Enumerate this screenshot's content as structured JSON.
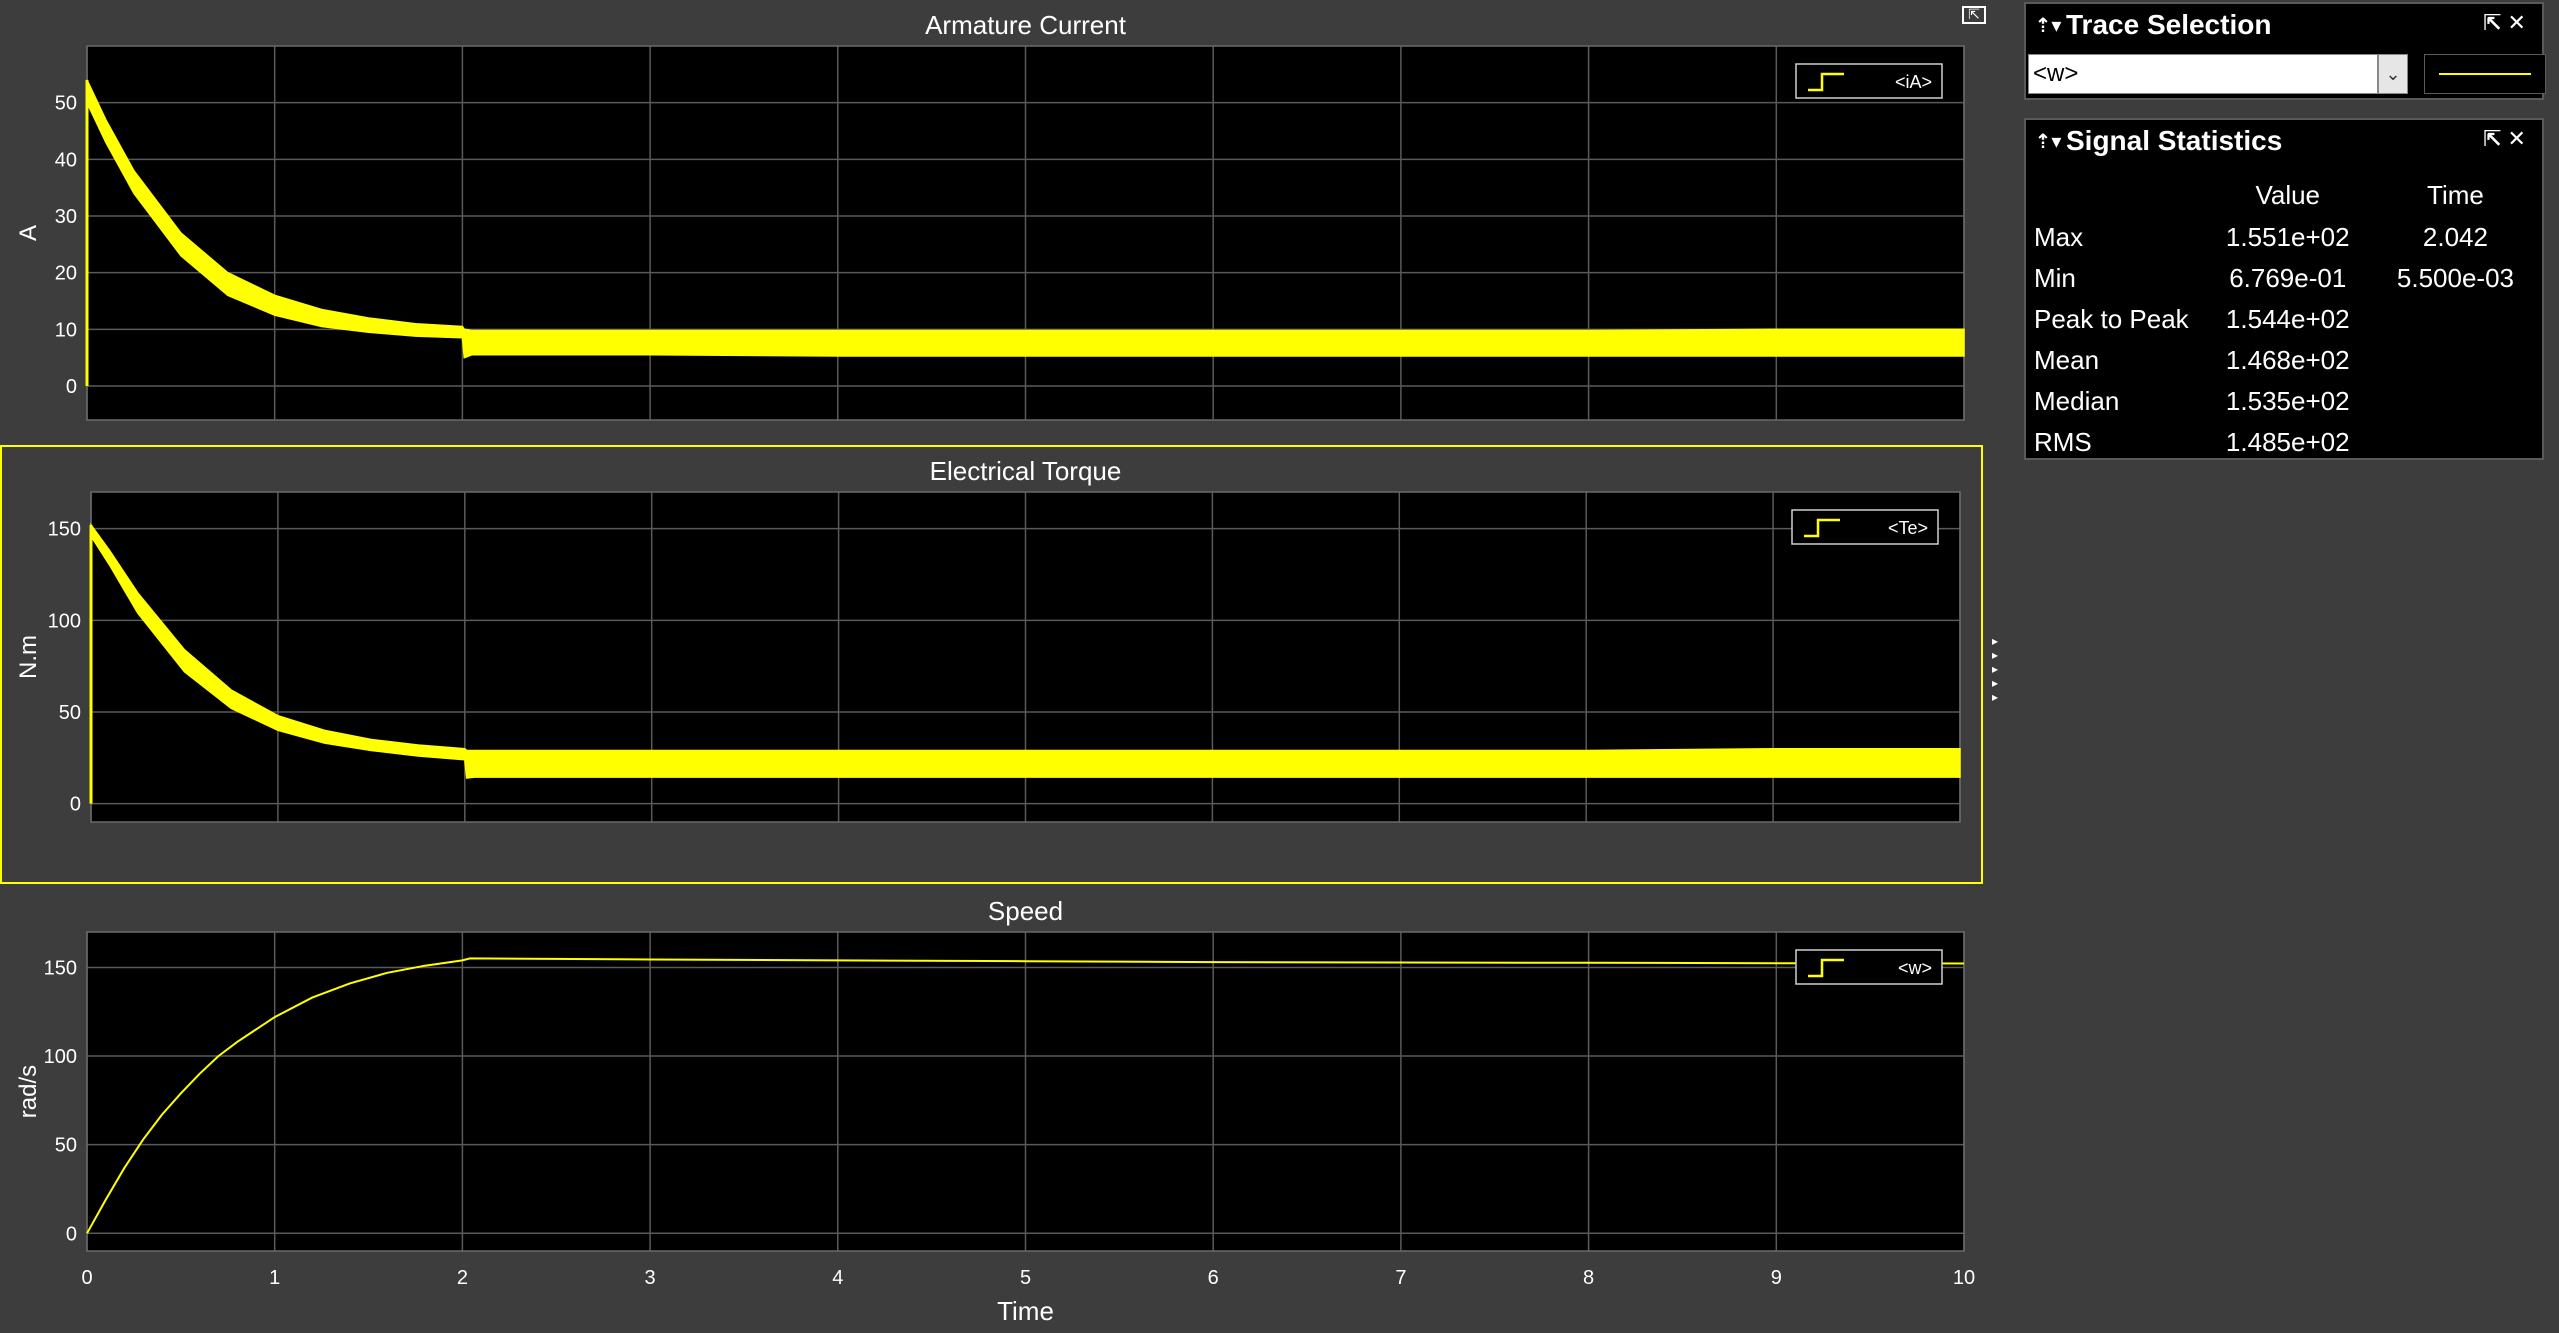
{
  "plots": [
    {
      "title": "Armature Current",
      "ylabel": "A",
      "yticks": [
        "0",
        "10",
        "20",
        "30",
        "40",
        "50"
      ],
      "legend": "<iA>",
      "selected": false
    },
    {
      "title": "Electrical Torque",
      "ylabel": "N.m",
      "yticks": [
        "0",
        "50",
        "100",
        "150"
      ],
      "legend": "<Te>",
      "selected": true
    },
    {
      "title": "Speed",
      "ylabel": "rad/s",
      "yticks": [
        "0",
        "50",
        "100",
        "150"
      ],
      "legend": "<w>",
      "selected": false
    }
  ],
  "xaxis": {
    "label": "Time",
    "ticks": [
      "0",
      "1",
      "2",
      "3",
      "4",
      "5",
      "6",
      "7",
      "8",
      "9",
      "10"
    ]
  },
  "chart_data": [
    {
      "type": "line",
      "title": "Armature Current",
      "xlabel": "",
      "ylabel": "A",
      "xlim": [
        0,
        10
      ],
      "ylim": [
        -6,
        60
      ],
      "series": [
        {
          "name": "<iA>",
          "color": "#ffff00",
          "x": [
            0,
            0.1,
            0.25,
            0.5,
            0.75,
            1.0,
            1.25,
            1.5,
            1.75,
            2.0,
            2.01,
            2.05,
            3,
            4,
            5,
            6,
            7,
            8,
            9,
            10
          ],
          "upper": [
            54,
            47,
            38,
            27,
            20,
            16,
            13.5,
            12,
            11,
            10.5,
            10,
            9.8,
            9.8,
            9.8,
            9.8,
            9.8,
            9.8,
            9.8,
            10,
            10
          ],
          "lower": [
            50,
            43,
            34,
            23,
            16,
            12.5,
            10.5,
            9.5,
            8.8,
            8.5,
            5,
            5.5,
            5.5,
            5.3,
            5.3,
            5.3,
            5.3,
            5.3,
            5.3,
            5.3
          ]
        }
      ]
    },
    {
      "type": "line",
      "title": "Electrical Torque",
      "xlabel": "",
      "ylabel": "N.m",
      "xlim": [
        0,
        10
      ],
      "ylim": [
        -10,
        170
      ],
      "series": [
        {
          "name": "<Te>",
          "color": "#ffff00",
          "x": [
            0,
            0.1,
            0.25,
            0.5,
            0.75,
            1.0,
            1.25,
            1.5,
            1.75,
            2.0,
            2.01,
            2.05,
            3,
            4,
            5,
            6,
            7,
            8,
            9,
            10
          ],
          "upper": [
            152,
            138,
            115,
            84,
            62,
            48,
            40,
            35,
            32,
            30,
            29,
            29,
            29,
            29,
            29,
            29,
            29,
            29,
            30,
            30
          ],
          "lower": [
            146,
            130,
            104,
            72,
            52,
            40,
            33,
            29,
            26,
            24,
            14,
            14.5,
            14.5,
            14.5,
            14.5,
            14.5,
            14.5,
            14.5,
            14.5,
            14.5
          ]
        }
      ]
    },
    {
      "type": "line",
      "title": "Speed",
      "xlabel": "Time",
      "ylabel": "rad/s",
      "xlim": [
        0,
        10
      ],
      "ylim": [
        -10,
        170
      ],
      "series": [
        {
          "name": "<w>",
          "color": "#ffff00",
          "x": [
            0,
            0.1,
            0.2,
            0.3,
            0.4,
            0.5,
            0.6,
            0.7,
            0.8,
            1.0,
            1.2,
            1.4,
            1.6,
            1.8,
            2.0,
            2.04,
            3,
            4,
            5,
            6,
            7,
            8,
            9,
            10
          ],
          "y": [
            0,
            19,
            37,
            53,
            67,
            79,
            90,
            100,
            108,
            122,
            133,
            141,
            147,
            151,
            154,
            155.1,
            154.5,
            154,
            153.5,
            153,
            152.8,
            152.6,
            152.4,
            152.2
          ]
        }
      ]
    }
  ],
  "trace_selection": {
    "title": "Trace Selection",
    "selected": "<w>"
  },
  "signal_statistics": {
    "title": "Signal Statistics",
    "col_value": "Value",
    "col_time": "Time",
    "rows": [
      {
        "label": "Max",
        "value": "1.551e+02",
        "time": "2.042"
      },
      {
        "label": "Min",
        "value": "6.769e-01",
        "time": "5.500e-03"
      },
      {
        "label": "Peak to Peak",
        "value": "1.544e+02",
        "time": ""
      },
      {
        "label": "Mean",
        "value": "1.468e+02",
        "time": ""
      },
      {
        "label": "Median",
        "value": "1.535e+02",
        "time": ""
      },
      {
        "label": "RMS",
        "value": "1.485e+02",
        "time": ""
      }
    ]
  },
  "colors": {
    "background": "#3d3d3d",
    "axes": "#000000",
    "grid": "#5a5a5a",
    "trace": "#ffff00",
    "selection": "#ffff00"
  }
}
